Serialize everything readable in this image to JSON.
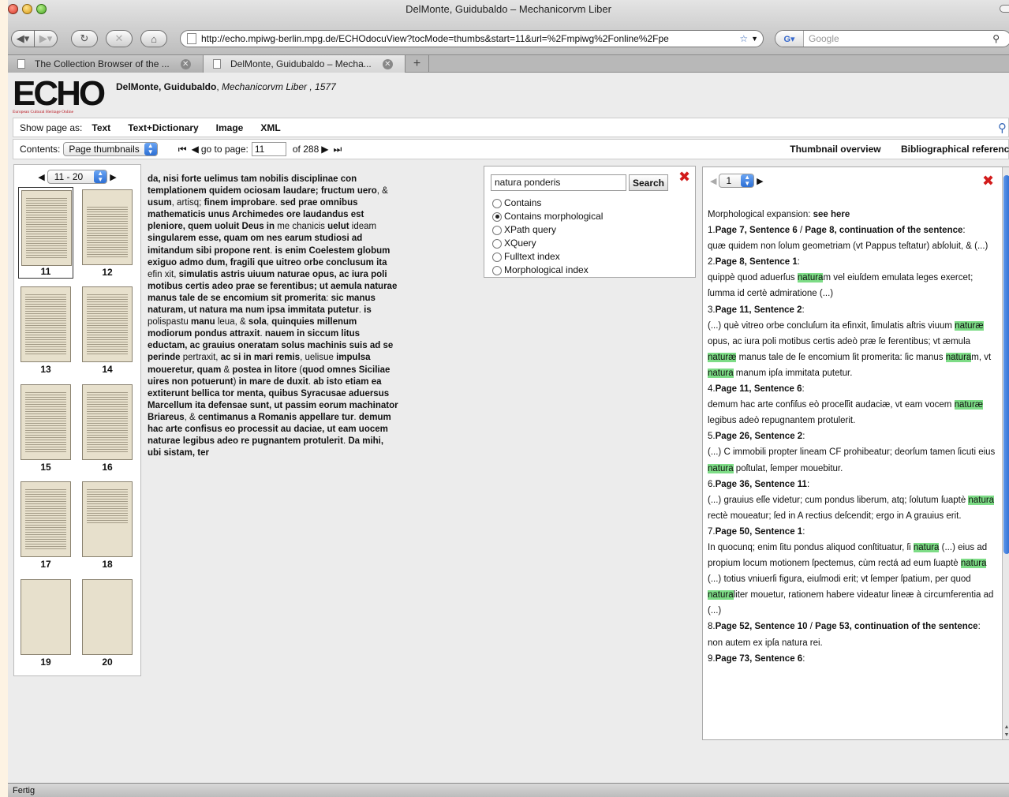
{
  "window": {
    "title": "DelMonte, Guidubaldo – Mechanicorvm Liber"
  },
  "toolbar": {
    "url": "http://echo.mpiwg-berlin.mpg.de/ECHOdocuView?tocMode=thumbs&start=11&url=%2Fmpiwg%2Fonline%2Fpe",
    "search_placeholder": "Google"
  },
  "tabs": [
    {
      "label": "The Collection Browser of the ..."
    },
    {
      "label": "DelMonte, Guidubaldo – Mecha..."
    }
  ],
  "header": {
    "logo_text": "ECHO",
    "logo_subtitle": "European Cultural Heritage Online",
    "author": "DelMonte, Guidubaldo",
    "sep": ", ",
    "work": "Mechanicorvm Liber",
    "year": " , 1577"
  },
  "show_as": {
    "label": "Show page as:",
    "options": [
      "Text",
      "Text+Dictionary",
      "Image",
      "XML"
    ]
  },
  "contents_bar": {
    "label": "Contents:",
    "mode": "Page thumbnails",
    "goto_label": "go to page:",
    "page": "11",
    "of_label": "of 288",
    "links": [
      "Thumbnail overview",
      "Bibliographical reference"
    ]
  },
  "thumbnails": {
    "range": "11 - 20",
    "pages": [
      "11",
      "12",
      "13",
      "14",
      "15",
      "16",
      "17",
      "18",
      "19",
      "20"
    ]
  },
  "search": {
    "query": "natura ponderis",
    "button": "Search",
    "options": [
      "Contains",
      "Contains morphological",
      "XPath query",
      "XQuery",
      "Fulltext index",
      "Morphological index"
    ],
    "selected": "Contains morphological"
  },
  "results": {
    "page": "1",
    "expansion_label": "Morphological expansion:",
    "expansion_link": "see here"
  },
  "status": {
    "text": "Fertig"
  }
}
